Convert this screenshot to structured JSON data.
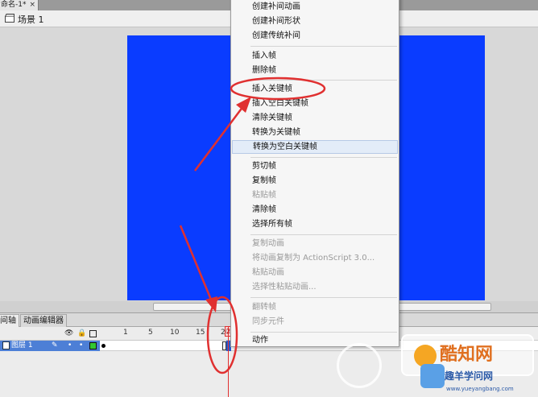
{
  "doc_tab": {
    "title": "命名-1*",
    "close": "×"
  },
  "scene": {
    "label": "场景 1"
  },
  "timeline": {
    "tabs": [
      "间轴",
      "动画编辑器"
    ],
    "ruler": [
      "1",
      "5",
      "10",
      "15",
      "20",
      "2"
    ],
    "layer": {
      "name": "图层 1"
    },
    "playhead": "2"
  },
  "menu": {
    "items": [
      {
        "label": "创建补间动画",
        "disabled": false
      },
      {
        "label": "创建补间形状",
        "disabled": false
      },
      {
        "label": "创建传统补间",
        "disabled": false
      },
      {
        "label": "插入帧",
        "disabled": false
      },
      {
        "label": "删除帧",
        "disabled": false
      },
      {
        "label": "插入关键帧",
        "disabled": false
      },
      {
        "label": "插入空白关键帧",
        "disabled": false
      },
      {
        "label": "清除关键帧",
        "disabled": false
      },
      {
        "label": "转换为关键帧",
        "disabled": false
      },
      {
        "label": "转换为空白关键帧",
        "disabled": false
      },
      {
        "label": "剪切帧",
        "disabled": false
      },
      {
        "label": "复制帧",
        "disabled": false
      },
      {
        "label": "粘贴帧",
        "disabled": true
      },
      {
        "label": "清除帧",
        "disabled": false
      },
      {
        "label": "选择所有帧",
        "disabled": false
      },
      {
        "label": "复制动画",
        "disabled": true
      },
      {
        "label": "将动画复制为 ActionScript 3.0...",
        "disabled": true
      },
      {
        "label": "粘贴动画",
        "disabled": true
      },
      {
        "label": "选择性粘贴动画...",
        "disabled": true
      },
      {
        "label": "翻转帧",
        "disabled": true
      },
      {
        "label": "同步元件",
        "disabled": true
      },
      {
        "label": "动作",
        "disabled": false
      }
    ]
  },
  "watermark": {
    "logo_text": "酷知网",
    "brand": "趣羊学问网",
    "url": "www.yueyangbang.com"
  },
  "colors": {
    "stage": "#0a3cff",
    "annotation": "#e03030",
    "layer_selected": "#4d7fd6"
  }
}
